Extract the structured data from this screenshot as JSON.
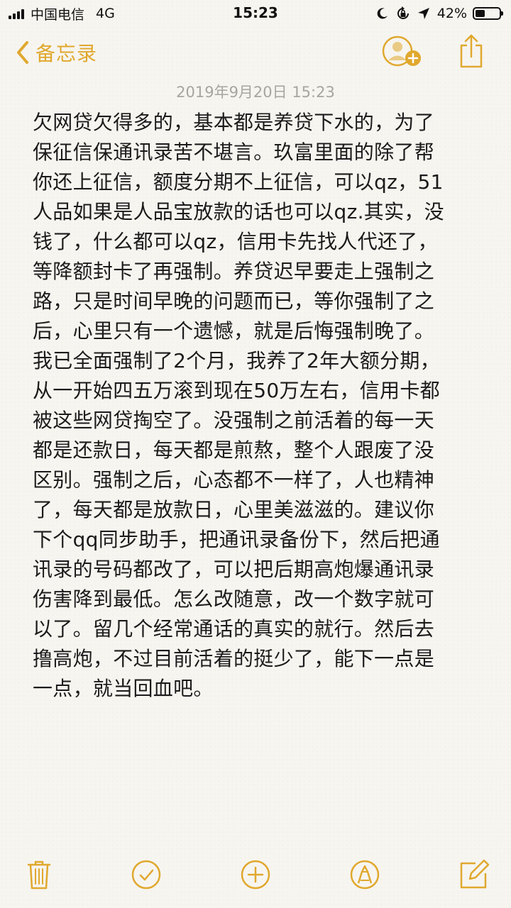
{
  "status_bar": {
    "carrier": "中国电信",
    "network": "4G",
    "time": "15:23",
    "battery_text": "42%",
    "battery_level": 0.42
  },
  "nav": {
    "back_label": "备忘录"
  },
  "note": {
    "date": "2019年9月20日 15:23",
    "lines": [
      "欠网贷欠得多的，基本都是养贷下水的，为了",
      "保征信保通讯录苦不堪言。玖富里面的除了帮",
      "你还上征信，额度分期不上征信，可以qz，51",
      "人品如果是人品宝放款的话也可以qz.其实，没",
      "钱了，什么都可以qz，信用卡先找人代还了，",
      "等降额封卡了再强制。养贷迟早要走上强制之",
      "路，只是时间早晚的问题而已，等你强制了之",
      "后，心里只有一个遗憾，就是后悔强制晚了。",
      "我已全面强制了2个月，我养了2年大额分期，",
      "从一开始四五万滚到现在50万左右，信用卡都",
      "被这些网贷掏空了。没强制之前活着的每一天",
      "都是还款日，每天都是煎熬，整个人跟废了没",
      "区别。强制之后，心态都不一样了，人也精神",
      "了，每天都是放款日，心里美滋滋的。建议你",
      "下个qq同步助手，把通讯录备份下，然后把通",
      "讯录的号码都改了，可以把后期高炮爆通讯录",
      "伤害降到最低。怎么改随意，改一个数字就可",
      "以了。留几个经常通话的真实的就行。然后去",
      "撸高炮，不过目前活着的挺少了，能下一点是",
      "一点，就当回血吧。"
    ]
  },
  "colors": {
    "accent": "#e0a82e",
    "background": "#f7f5f0",
    "date_text": "#a8a59f"
  },
  "icons": {
    "back": "chevron-left-icon",
    "collab": "add-person-icon",
    "share": "share-icon",
    "delete": "trash-icon",
    "checklist": "checkmark-circle-icon",
    "add": "plus-circle-icon",
    "markup": "pen-tip-icon",
    "compose": "compose-icon"
  }
}
